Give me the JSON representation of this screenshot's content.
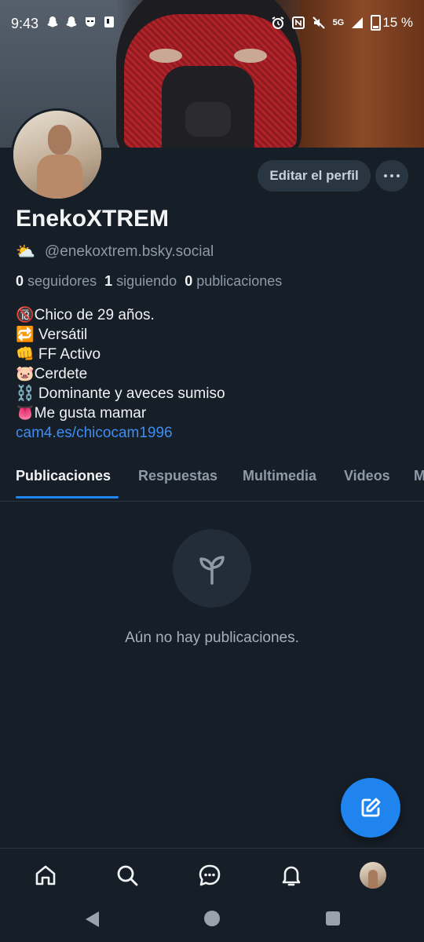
{
  "status_bar": {
    "time": "9:43",
    "network": "5G",
    "battery": "15 %"
  },
  "profile": {
    "display_name": "EnekoXTREM",
    "handle_emoji": "⛅",
    "handle": "@enekoxtrem.bsky.social",
    "edit_button": "Editar el perfil",
    "stats": {
      "followers_count": "0",
      "followers_label": "seguidores",
      "following_count": "1",
      "following_label": "siguiendo",
      "posts_count": "0",
      "posts_label": "publicaciones"
    },
    "bio_lines": [
      "🔞Chico de 29 años.",
      "🔁 Versátil",
      "👊 FF Activo",
      "🐷Cerdete",
      "⛓️ Dominante y aveces sumiso",
      "👅Me gusta mamar"
    ],
    "bio_link": "cam4.es/chicocam1996"
  },
  "tabs": [
    "Publicaciones",
    "Respuestas",
    "Multimedia",
    "Videos",
    "M"
  ],
  "active_tab": "Publicaciones",
  "empty_state": {
    "icon": "sprout-icon",
    "text": "Aún no hay publicaciones."
  },
  "bottom_nav": [
    "home-icon",
    "search-icon",
    "chat-icon",
    "bell-icon",
    "profile-avatar"
  ],
  "colors": {
    "background": "#161e27",
    "accent": "#1f84ee",
    "link": "#3d8df5",
    "muted_text": "#8e9aa8"
  }
}
